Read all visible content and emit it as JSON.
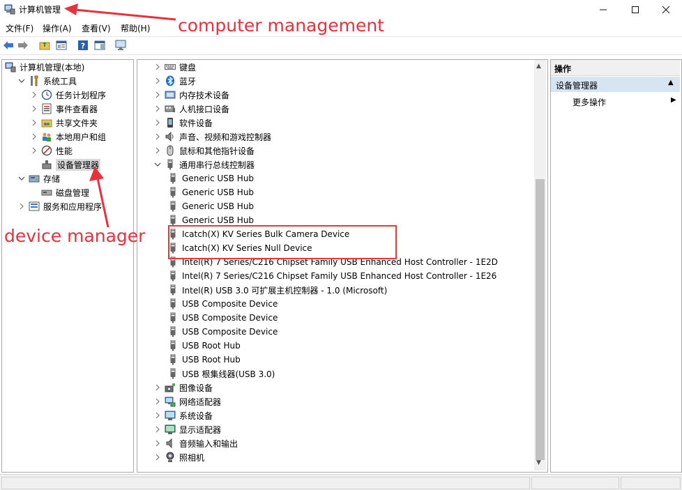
{
  "window": {
    "title": "计算机管理",
    "controls": [
      "minimize",
      "maximize",
      "close"
    ]
  },
  "menu": [
    "文件(F)",
    "操作(A)",
    "查看(V)",
    "帮助(H)"
  ],
  "toolbar": [
    "back-arrow-icon",
    "forward-arrow-icon",
    "up-folder-icon",
    "properties-icon",
    "help-icon",
    "show-hide-icon",
    "monitor-icon"
  ],
  "left_tree": [
    {
      "label": "计算机管理(本地)",
      "level": 0,
      "expander": "",
      "icon": "computer-management-icon"
    },
    {
      "label": "系统工具",
      "level": 1,
      "expander": "expanded",
      "icon": "tools-icon"
    },
    {
      "label": "任务计划程序",
      "level": 2,
      "expander": "collapsed",
      "icon": "clock-icon"
    },
    {
      "label": "事件查看器",
      "level": 2,
      "expander": "collapsed",
      "icon": "event-viewer-icon"
    },
    {
      "label": "共享文件夹",
      "level": 2,
      "expander": "collapsed",
      "icon": "shared-folder-icon"
    },
    {
      "label": "本地用户和组",
      "level": 2,
      "expander": "collapsed",
      "icon": "users-icon"
    },
    {
      "label": "性能",
      "level": 2,
      "expander": "collapsed",
      "icon": "performance-icon"
    },
    {
      "label": "设备管理器",
      "level": 2,
      "expander": "",
      "icon": "device-manager-icon",
      "selected": true
    },
    {
      "label": "存储",
      "level": 1,
      "expander": "expanded",
      "icon": "storage-icon"
    },
    {
      "label": "磁盘管理",
      "level": 2,
      "expander": "",
      "icon": "disk-icon"
    },
    {
      "label": "服务和应用程序",
      "level": 1,
      "expander": "collapsed",
      "icon": "services-icon"
    }
  ],
  "device_tree": [
    {
      "label": "键盘",
      "level": 0,
      "expander": "collapsed",
      "icon": "keyboard-icon"
    },
    {
      "label": "蓝牙",
      "level": 0,
      "expander": "collapsed",
      "icon": "bluetooth-icon"
    },
    {
      "label": "内存技术设备",
      "level": 0,
      "expander": "collapsed",
      "icon": "memory-icon"
    },
    {
      "label": "人机接口设备",
      "level": 0,
      "expander": "collapsed",
      "icon": "hid-icon"
    },
    {
      "label": "软件设备",
      "level": 0,
      "expander": "collapsed",
      "icon": "software-device-icon"
    },
    {
      "label": "声音、视频和游戏控制器",
      "level": 0,
      "expander": "collapsed",
      "icon": "speaker-icon"
    },
    {
      "label": "鼠标和其他指针设备",
      "level": 0,
      "expander": "collapsed",
      "icon": "mouse-icon"
    },
    {
      "label": "通用串行总线控制器",
      "level": 0,
      "expander": "expanded",
      "icon": "usb-icon"
    },
    {
      "label": "Generic USB Hub",
      "level": 1,
      "icon": "usb-icon"
    },
    {
      "label": "Generic USB Hub",
      "level": 1,
      "icon": "usb-icon"
    },
    {
      "label": "Generic USB Hub",
      "level": 1,
      "icon": "usb-icon"
    },
    {
      "label": "Generic USB Hub",
      "level": 1,
      "icon": "usb-icon"
    },
    {
      "label": "Icatch(X) KV Series Bulk Camera Device",
      "level": 1,
      "icon": "usb-icon"
    },
    {
      "label": "Icatch(X) KV Series Null Device",
      "level": 1,
      "icon": "usb-icon"
    },
    {
      "label": "Intel(R) 7 Series/C216 Chipset Family USB Enhanced Host Controller - 1E2D",
      "level": 1,
      "icon": "usb-icon"
    },
    {
      "label": "Intel(R) 7 Series/C216 Chipset Family USB Enhanced Host Controller - 1E26",
      "level": 1,
      "icon": "usb-icon"
    },
    {
      "label": "Intel(R) USB 3.0 可扩展主机控制器 - 1.0 (Microsoft)",
      "level": 1,
      "icon": "usb-icon"
    },
    {
      "label": "USB Composite Device",
      "level": 1,
      "icon": "usb-icon"
    },
    {
      "label": "USB Composite Device",
      "level": 1,
      "icon": "usb-icon"
    },
    {
      "label": "USB Composite Device",
      "level": 1,
      "icon": "usb-icon"
    },
    {
      "label": "USB Root Hub",
      "level": 1,
      "icon": "usb-icon"
    },
    {
      "label": "USB Root Hub",
      "level": 1,
      "icon": "usb-icon"
    },
    {
      "label": "USB 根集线器(USB 3.0)",
      "level": 1,
      "icon": "usb-icon"
    },
    {
      "label": "图像设备",
      "level": 0,
      "expander": "collapsed",
      "icon": "camera-device-icon"
    },
    {
      "label": "网络适配器",
      "level": 0,
      "expander": "collapsed",
      "icon": "network-icon"
    },
    {
      "label": "系统设备",
      "level": 0,
      "expander": "collapsed",
      "icon": "system-device-icon"
    },
    {
      "label": "显示适配器",
      "level": 0,
      "expander": "collapsed",
      "icon": "display-icon"
    },
    {
      "label": "音频输入和输出",
      "level": 0,
      "expander": "collapsed",
      "icon": "audio-icon"
    },
    {
      "label": "照相机",
      "level": 0,
      "expander": "collapsed",
      "icon": "webcam-icon"
    }
  ],
  "actions": {
    "header": "操作",
    "section": "设备管理器",
    "more": "更多操作"
  },
  "annotations": {
    "top": "computer management",
    "side": "device manager",
    "color": "#e8313a"
  }
}
